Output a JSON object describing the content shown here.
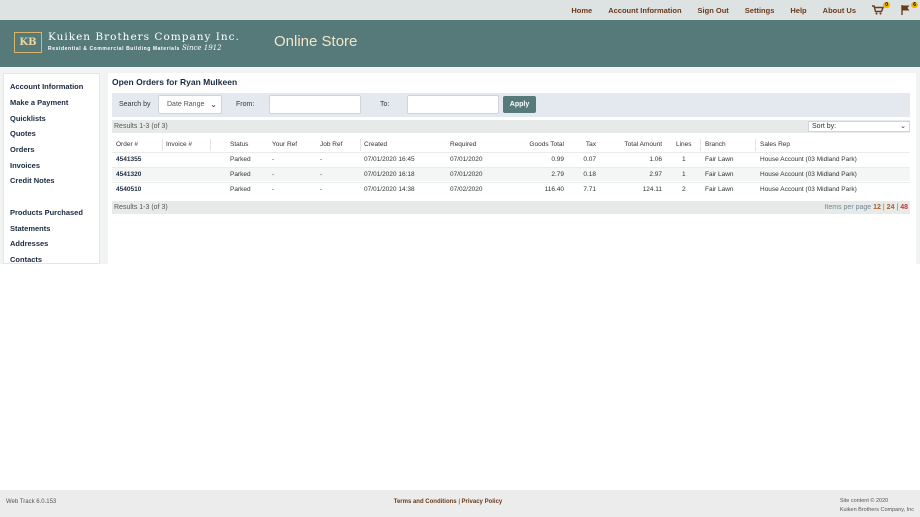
{
  "topnav": {
    "home": "Home",
    "account_information": "Account Information",
    "sign_out": "Sign Out",
    "settings": "Settings",
    "help": "Help",
    "about_us": "About Us",
    "cart_count": "0",
    "flag_count": "6"
  },
  "header": {
    "logo_text": "KB",
    "company_name": "Kuiken Brothers Company Inc.",
    "company_sub": "Residential & Commercial Building Materials",
    "since": "Since 1912",
    "store_title": "Online Store"
  },
  "sidebar": {
    "items": [
      {
        "label": "Account Information"
      },
      {
        "label": "Make a Payment"
      },
      {
        "label": "Quicklists"
      },
      {
        "label": "Quotes"
      },
      {
        "label": "Orders"
      },
      {
        "label": "Invoices"
      },
      {
        "label": "Credit Notes"
      },
      {
        "label": "Products Purchased"
      },
      {
        "label": "Statements"
      },
      {
        "label": "Addresses"
      },
      {
        "label": "Contacts"
      }
    ]
  },
  "main": {
    "title": "Open Orders for Ryan Mulkeen",
    "search": {
      "search_by_label": "Search by",
      "search_by_value": "Date Range",
      "from_label": "From:",
      "from_value": "",
      "to_label": "To:",
      "to_value": "",
      "apply_label": "Apply"
    },
    "results_text": "Results 1-3 (of 3)",
    "sort_label": "Sort by:",
    "columns": [
      "Order #",
      "Invoice #",
      "Status",
      "Your Ref",
      "Job Ref",
      "Created",
      "Required",
      "Goods Total",
      "Tax",
      "Total Amount",
      "Lines",
      "Branch",
      "Sales Rep"
    ],
    "rows": [
      {
        "order": "4541355",
        "invoice": "",
        "status": "Parked",
        "your_ref": "-",
        "job_ref": "-",
        "created": "07/01/2020 16:45",
        "required": "07/01/2020",
        "goods_total": "0.99",
        "tax": "0.07",
        "total_amount": "1.06",
        "lines": "1",
        "branch": "Fair Lawn",
        "sales_rep": "House Account (03 Midland Park)"
      },
      {
        "order": "4541320",
        "invoice": "",
        "status": "Parked",
        "your_ref": "-",
        "job_ref": "-",
        "created": "07/01/2020 16:18",
        "required": "07/01/2020",
        "goods_total": "2.79",
        "tax": "0.18",
        "total_amount": "2.97",
        "lines": "1",
        "branch": "Fair Lawn",
        "sales_rep": "House Account (03 Midland Park)"
      },
      {
        "order": "4540510",
        "invoice": "",
        "status": "Parked",
        "your_ref": "-",
        "job_ref": "-",
        "created": "07/01/2020 14:38",
        "required": "07/02/2020",
        "goods_total": "116.40",
        "tax": "7.71",
        "total_amount": "124.11",
        "lines": "2",
        "branch": "Fair Lawn",
        "sales_rep": "House Account (03 Midland Park)"
      }
    ],
    "pager": {
      "label": "Items per page",
      "opt1": "12",
      "opt2": "24",
      "opt3": "48",
      "sep": "|"
    }
  },
  "footer": {
    "version": "Web Track 6.0.153",
    "terms": "Terms and Conditions",
    "sep": "|",
    "privacy": "Privacy Policy",
    "copyright_line1": "Site content © 2020",
    "copyright_line2": "Kuiken Brothers Company, Inc"
  },
  "colors": {
    "header_bg": "#567a7a",
    "nav_link": "#6b3a1a",
    "accent": "#b05a20",
    "current_page": "#c0392b"
  }
}
